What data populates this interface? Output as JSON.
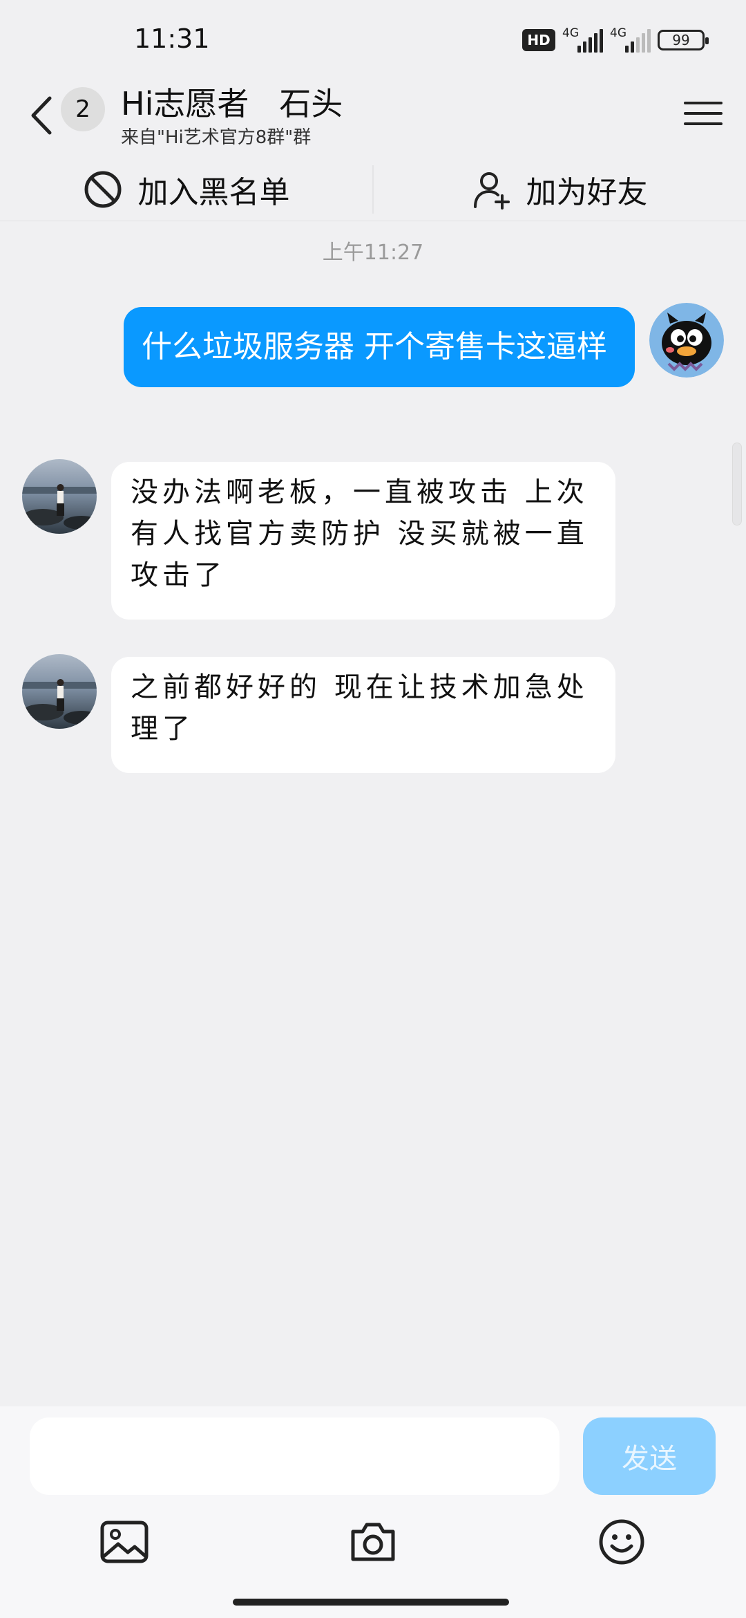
{
  "status_bar": {
    "time": "11:31",
    "hd_label": "HD",
    "network_1": "4G",
    "network_2": "4G",
    "battery": "99"
  },
  "header": {
    "unread_count": "2",
    "title": "Hi志愿者   石头",
    "subtitle": "来自\"Hi艺术官方8群\"群"
  },
  "actions": {
    "blacklist_label": "加入黑名单",
    "add_friend_label": "加为好友"
  },
  "chat": {
    "timestamp": "上午11:27",
    "messages": [
      {
        "direction": "outgoing",
        "text": "什么垃圾服务器  开个寄售卡这逼样"
      },
      {
        "direction": "incoming",
        "text": "没办法啊老板，一直被攻击  上次有人找官方卖防护  没买就被一直攻击了"
      },
      {
        "direction": "incoming",
        "text": "之前都好好的  现在让技术加急处理了"
      }
    ]
  },
  "input": {
    "placeholder": "",
    "value": "",
    "send_label": "发送"
  },
  "icons": {
    "back": "chevron-left-icon",
    "menu": "hamburger-menu-icon",
    "blacklist": "block-icon",
    "add_friend": "add-user-icon",
    "image": "image-icon",
    "camera": "camera-icon",
    "emoji": "emoji-icon"
  },
  "colors": {
    "accent": "#0a99ff",
    "send_disabled": "#8cd0ff",
    "background": "#f0f0f2"
  }
}
